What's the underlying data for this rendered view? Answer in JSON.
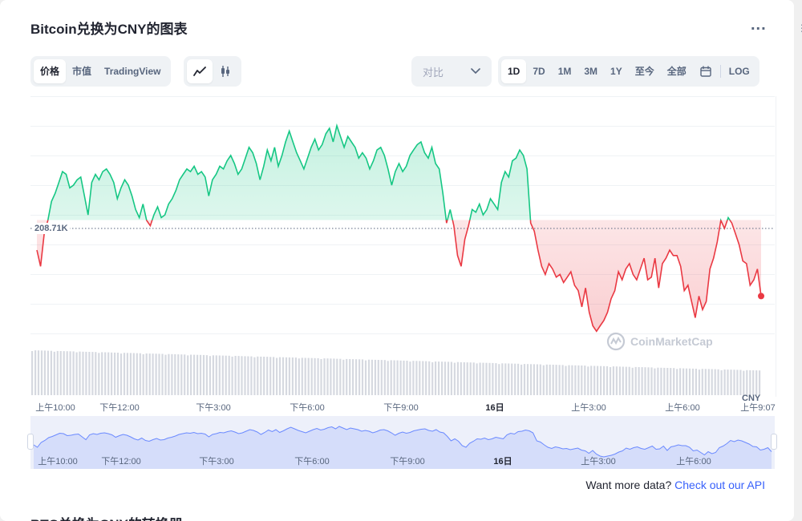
{
  "header": {
    "title": "Bitcoin兑换为CNY的图表",
    "more_label": "..."
  },
  "toolbar": {
    "view_tabs": [
      "价格",
      "市值",
      "TradingView"
    ],
    "compare_label": "对比",
    "range_tabs": [
      "1D",
      "7D",
      "1M",
      "3M",
      "1Y",
      "至今",
      "全部"
    ],
    "log_label": "LOG"
  },
  "chart": {
    "price_label": "208.71K",
    "currency_label": "CNY",
    "watermark": "CoinMarketCap",
    "x_ticks": [
      "上午10:00",
      "下午12:00",
      "下午3:00",
      "下午6:00",
      "下午9:00",
      "16日",
      "上午3:00",
      "上午6:00",
      "上午9:07"
    ],
    "navigator_ticks": [
      "上午10:00",
      "下午12:00",
      "下午3:00",
      "下午6:00",
      "下午9:00",
      "16日",
      "上午3:00",
      "上午6:00"
    ]
  },
  "footer": {
    "api_text": "Want more data?",
    "api_link": "Check out our API",
    "next_section": "BTC兑换为CNY的转换器"
  },
  "colors": {
    "up": "#16c784",
    "down": "#ea3943",
    "accent": "#3861fb",
    "navigator": "#6b8aff"
  },
  "chart_data": {
    "type": "line",
    "baseline": 208.71,
    "unit": "K CNY",
    "values": [
      207.6,
      207.0,
      208.2,
      208.7,
      209.4,
      209.7,
      210.1,
      210.5,
      210.4,
      209.9,
      210.0,
      210.2,
      210.3,
      209.6,
      208.9,
      210.1,
      210.4,
      210.2,
      210.5,
      210.6,
      210.4,
      210.1,
      209.5,
      209.9,
      210.2,
      210.0,
      209.6,
      209.1,
      208.8,
      209.3,
      208.7,
      208.5,
      208.9,
      209.2,
      208.8,
      208.9,
      209.3,
      209.5,
      209.8,
      210.2,
      210.4,
      210.6,
      210.5,
      210.7,
      210.4,
      210.5,
      210.3,
      209.6,
      210.2,
      210.4,
      210.7,
      210.6,
      210.9,
      211.1,
      210.8,
      210.4,
      210.6,
      211.0,
      211.4,
      211.2,
      210.8,
      210.2,
      210.7,
      211.3,
      210.9,
      211.4,
      210.7,
      211.1,
      211.6,
      212.0,
      211.6,
      211.2,
      210.9,
      210.6,
      211.0,
      211.4,
      211.7,
      211.3,
      211.5,
      211.9,
      212.1,
      211.6,
      212.2,
      211.8,
      211.4,
      211.8,
      211.6,
      211.4,
      211.0,
      211.2,
      211.0,
      210.6,
      210.9,
      211.3,
      211.4,
      211.1,
      210.6,
      210.0,
      210.5,
      210.8,
      210.5,
      210.7,
      211.1,
      211.3,
      211.5,
      211.6,
      211.2,
      211.0,
      211.4,
      210.8,
      210.6,
      209.7,
      208.6,
      209.1,
      208.5,
      207.4,
      207.0,
      208.0,
      208.5,
      209.1,
      209.0,
      209.3,
      208.9,
      209.1,
      209.5,
      209.3,
      209.1,
      210.1,
      210.5,
      210.3,
      210.9,
      211.0,
      211.3,
      211.1,
      210.6,
      208.6,
      208.3,
      207.6,
      207.0,
      206.7,
      207.1,
      206.9,
      206.6,
      206.7,
      206.4,
      206.6,
      206.8,
      206.3,
      206.1,
      205.5,
      206.2,
      205.3,
      204.8,
      204.6,
      204.8,
      205.0,
      205.3,
      205.8,
      206.1,
      206.8,
      206.5,
      206.9,
      207.1,
      206.7,
      206.5,
      206.9,
      207.3,
      206.5,
      206.6,
      207.3,
      206.2,
      207.1,
      207.3,
      207.6,
      207.4,
      207.4,
      207.0,
      206.1,
      206.3,
      205.7,
      205.1,
      205.9,
      205.4,
      205.7,
      206.9,
      207.3,
      207.9,
      208.7,
      208.4,
      208.8,
      208.6,
      208.2,
      207.8,
      207.2,
      207.1,
      206.3,
      206.5,
      206.9,
      205.9
    ]
  }
}
